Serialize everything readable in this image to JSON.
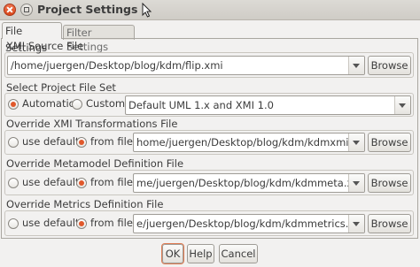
{
  "window": {
    "title": "Project Settings"
  },
  "tabs": [
    {
      "label": "File Settings",
      "active": true
    },
    {
      "label": "Filter Settings",
      "active": false
    }
  ],
  "xmi_source": {
    "group_label": "XMI Source File",
    "path": "/home/juergen/Desktop/blog/kdm/flip.xmi",
    "browse_label": "Browse"
  },
  "project_file_set": {
    "group_label": "Select Project File Set",
    "automatic_label": "Automatic",
    "custom_label": "Custom:",
    "selected": "Automatic",
    "combo_value": "Default UML 1.x and XMI 1.0"
  },
  "xmi_transformations": {
    "group_label": "Override XMI Transformations File",
    "use_default_label": "use default",
    "from_file_label": "from file:",
    "selected": "from file",
    "path": "home/juergen/Desktop/blog/kdm/kdmxmi.xml",
    "browse_label": "Browse"
  },
  "metamodel_definition": {
    "group_label": "Override Metamodel Definition File",
    "use_default_label": "use default",
    "from_file_label": "from file:",
    "selected": "from file",
    "path": "me/juergen/Desktop/blog/kdm/kdmmeta.xml",
    "browse_label": "Browse"
  },
  "metrics_definition": {
    "group_label": "Override Metrics Definition File",
    "use_default_label": "use default",
    "from_file_label": "from file:",
    "selected": "from file",
    "path": "e/juergen/Desktop/blog/kdm/kdmmetrics.xml",
    "browse_label": "Browse"
  },
  "buttons": {
    "ok": "OK",
    "help": "Help",
    "cancel": "Cancel"
  },
  "colors": {
    "accent": "#e0582b",
    "titlebar": "#d7d4cf",
    "background": "#f2f1f0"
  },
  "icons": [
    "close-icon",
    "restore-icon",
    "mouse-pointer-icon",
    "dropdown-arrow-icon"
  ]
}
